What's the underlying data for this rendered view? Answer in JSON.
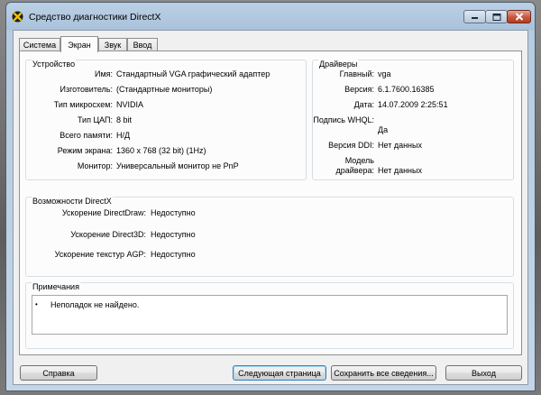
{
  "window": {
    "title": "Средство диагностики DirectX"
  },
  "tabs": [
    "Система",
    "Экран",
    "Звук",
    "Ввод"
  ],
  "active_tab": 1,
  "device": {
    "title": "Устройство",
    "rows": [
      {
        "label": "Имя:",
        "value": "Стандартный VGA графический адаптер"
      },
      {
        "label": "Изготовитель:",
        "value": "(Стандартные мониторы)"
      },
      {
        "label": "Тип микросхем:",
        "value": "NVIDIA"
      },
      {
        "label": "Тип ЦАП:",
        "value": "8 bit"
      },
      {
        "label": "Всего памяти:",
        "value": "Н/Д"
      },
      {
        "label": "Режим экрана:",
        "value": "1360 x 768 (32 bit) (1Hz)"
      },
      {
        "label": "Монитор:",
        "value": "Универсальный монитор не PnP"
      }
    ]
  },
  "drivers": {
    "title": "Драйверы",
    "main_label": "Главный:",
    "main_value": "vga",
    "version_label": "Версия:",
    "version_value": "6.1.7600.16385",
    "date_label": "Дата:",
    "date_value": "14.07.2009 2:25:51",
    "whql_label": "Подпись WHQL:",
    "whql_value": "Да",
    "ddi_label": "Версия DDI:",
    "ddi_value": "Нет данных",
    "model_label_1": "Модель",
    "model_label_2": "драйвера:",
    "model_value": "Нет данных"
  },
  "features": {
    "title": "Возможности DirectX",
    "rows": [
      {
        "label": "Ускорение DirectDraw:",
        "value": "Недоступно"
      },
      {
        "label": "Ускорение Direct3D:",
        "value": "Недоступно"
      },
      {
        "label": "Ускорение текстур AGP:",
        "value": "Недоступно"
      }
    ]
  },
  "notes": {
    "title": "Примечания",
    "bullet": "•",
    "items": [
      "Неполадок не найдено."
    ]
  },
  "buttons": {
    "help": "Справка",
    "next_page": "Следующая страница",
    "save_all": "Сохранить все сведения...",
    "exit": "Выход"
  },
  "colors": {
    "close_button": "#c95b43",
    "titlebar": "#a9c2db"
  },
  "icons": {
    "app": "directx-icon",
    "minimize": "minimize-icon",
    "maximize": "maximize-icon",
    "close": "close-icon"
  }
}
